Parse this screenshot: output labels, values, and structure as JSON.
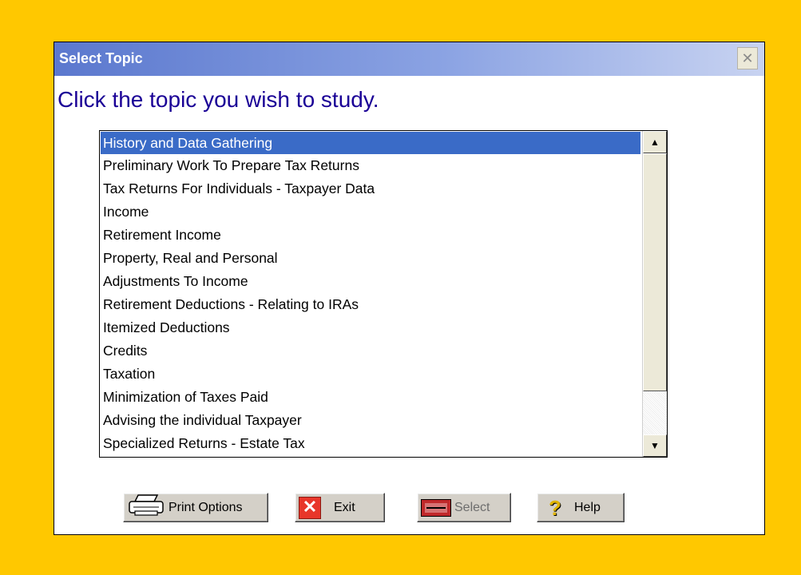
{
  "dialog": {
    "title": "Select Topic",
    "close_glyph": "✕",
    "prompt": "Click the topic you wish to study."
  },
  "topics": {
    "selected_index": 0,
    "items": [
      "History and Data Gathering",
      "Preliminary Work To Prepare Tax Returns",
      "Tax Returns For Individuals - Taxpayer Data",
      "Income",
      "Retirement Income",
      "Property, Real and Personal",
      "Adjustments To Income",
      "Retirement Deductions - Relating to IRAs",
      "Itemized Deductions",
      "Credits",
      "Taxation",
      "Minimization of Taxes Paid",
      "Advising the individual Taxpayer",
      "Specialized Returns - Estate Tax"
    ]
  },
  "scrollbar": {
    "up_glyph": "▲",
    "down_glyph": "▼"
  },
  "buttons": {
    "print_label": "Print Options",
    "exit_label": "Exit",
    "exit_glyph": "✕",
    "select_label": "Select",
    "help_label": "Help",
    "help_glyph": "?"
  },
  "icons": [
    "printer-icon",
    "exit-x-icon",
    "select-icon",
    "help-question-icon",
    "close-icon"
  ],
  "colors": {
    "background": "#ffc800",
    "title_gradient_start": "#5b78ce",
    "prompt_text": "#1a0096",
    "selection": "#3a6bc7",
    "exit_icon": "#e8362a"
  }
}
